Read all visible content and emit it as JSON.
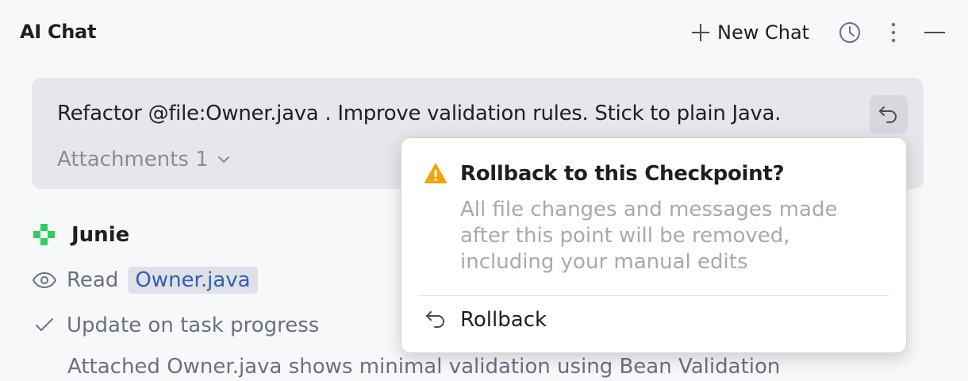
{
  "header": {
    "title": "AI Chat",
    "new_chat_label": "New Chat",
    "icons": [
      "plus-icon",
      "history-icon",
      "more-vertical-icon",
      "minimize-icon"
    ]
  },
  "prompt": {
    "text": "Refactor @file:Owner.java . Improve validation rules. Stick to plain Java.",
    "attachments_label": "Attachments 1"
  },
  "agent": {
    "name": "Junie",
    "steps": [
      {
        "label": "Read",
        "file": "Owner.java",
        "icon": "eye-icon"
      },
      {
        "label": "Update on task progress",
        "icon": "check-icon"
      }
    ],
    "description": "Attached Owner.java shows minimal validation using Bean Validation"
  },
  "rollback_popup": {
    "title": "Rollback to this Checkpoint?",
    "body": "All file changes and messages made after this point will be removed, including your manual edits",
    "action_label": "Rollback"
  },
  "colors": {
    "accent_link": "#2f5fb9",
    "warning": "#f2a60c",
    "junie_green": "#2fcf5f",
    "muted_text": "#6c707e"
  }
}
